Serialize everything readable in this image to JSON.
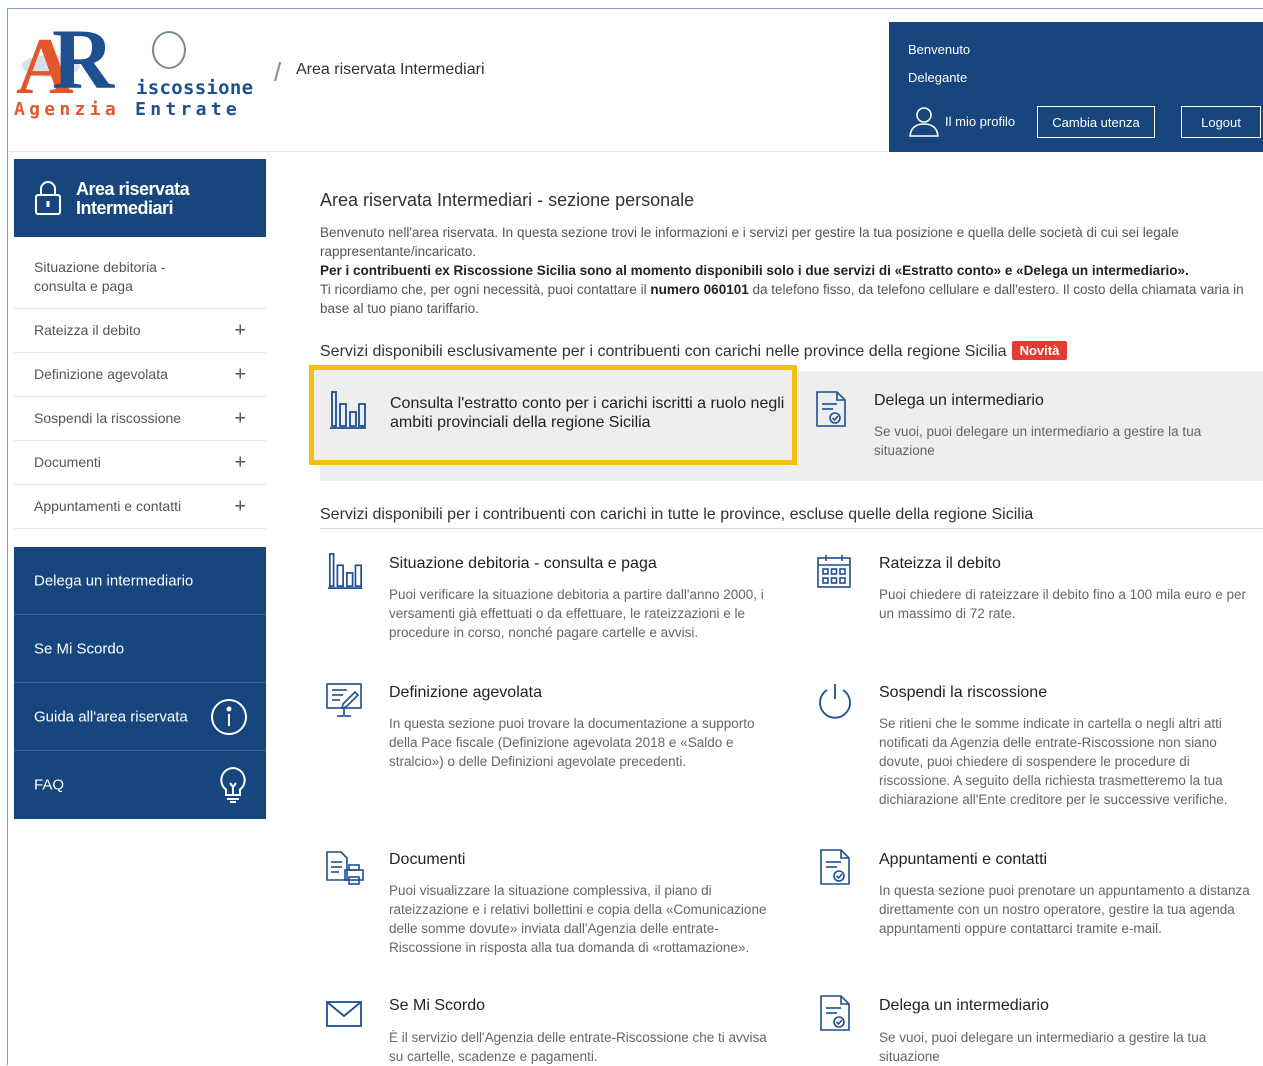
{
  "header": {
    "logo_iscossione": "iscossione",
    "logo_agenzia": "Agenzia",
    "logo_entrate": "Entrate",
    "breadcrumb": "Area riservata Intermediari",
    "user": {
      "welcome": "Benvenuto",
      "role": "Delegante",
      "profile": "Il mio profilo",
      "change_user": "Cambia utenza",
      "logout": "Logout"
    }
  },
  "sidebar": {
    "title_line1": "Area riservata",
    "title_line2": "Intermediari",
    "menu": [
      {
        "line1": "Situazione debitoria -",
        "line2": "consulta e paga"
      },
      {
        "label": "Rateizza il debito"
      },
      {
        "label": "Definizione agevolata"
      },
      {
        "label": "Sospendi la riscossione"
      },
      {
        "label": "Documenti"
      },
      {
        "label": "Appuntamenti e contatti"
      }
    ],
    "buttons": [
      {
        "label": "Delega un intermediario"
      },
      {
        "label": "Se Mi Scordo"
      },
      {
        "label": "Guida all'area riservata"
      },
      {
        "label": "FAQ"
      }
    ]
  },
  "main": {
    "title": "Area riservata Intermediari - sezione personale",
    "intro_1": "Benvenuto nell'area riservata. In questa sezione trovi le informazioni e i servizi per gestire la tua posizione e quella delle società di cui sei legale rappresentante/incaricato.",
    "intro_2": "Per i contribuenti ex Riscossione Sicilia sono al momento disponibili solo i due servizi di «Estratto conto» e «Delega un intermediario».",
    "intro_3a": "Ti ricordiamo che, per ogni necessità, puoi contattare il ",
    "intro_3b": "numero 060101",
    "intro_3c": " da telefono fisso, da telefono cellulare e dall'estero. Il costo della chiamata varia in base al tuo piano tariffario.",
    "sicily_section": "Servizi disponibili esclusivamente per i contribuenti con carichi nelle province della regione Sicilia",
    "badge_new": "Novità",
    "sicily_cards": [
      {
        "title": "Consulta l'estratto conto per i carichi iscritti a ruolo negli ambiti provinciali della regione Sicilia"
      },
      {
        "title": "Delega un intermediario",
        "desc": "Se vuoi, puoi delegare un intermediario a gestire la tua situazione"
      }
    ],
    "other_section": "Servizi disponibili per i contribuenti con carichi in tutte le province, escluse quelle della regione Sicilia",
    "services": [
      {
        "title": "Situazione debitoria - consulta e paga",
        "desc": "Puoi verificare la situazione debitoria a partire dall'anno 2000, i versamenti già effettuati o da effettuare, le rateizzazioni e le procedure in corso, nonché pagare cartelle e avvisi."
      },
      {
        "title": "Rateizza il debito",
        "desc": "Puoi chiedere di rateizzare il debito fino a 100 mila euro e per un massimo di 72 rate."
      },
      {
        "title": "Definizione agevolata",
        "desc": "In questa sezione puoi trovare la documentazione a supporto della Pace fiscale (Definizione agevolata 2018 e «Saldo e stralcio») o delle Definizioni agevolate precedenti."
      },
      {
        "title": "Sospendi la riscossione",
        "desc": "Se ritieni che le somme indicate in cartella o negli altri atti notificati da Agenzia delle entrate-Riscossione non siano dovute, puoi chiedere di sospendere le procedure di riscossione. A seguito della richiesta trasmetteremo la tua dichiarazione all'Ente creditore per le successive verifiche."
      },
      {
        "title": "Documenti",
        "desc": "Puoi visualizzare la situazione complessiva, il piano di rateizzazione e i relativi bollettini e copia della «Comunicazione delle somme dovute» inviata dall'Agenzia delle entrate-Riscossione in risposta alla tua domanda di «rottamazione»."
      },
      {
        "title": "Appuntamenti e contatti",
        "desc": "In questa sezione puoi prenotare un appuntamento a distanza direttamente con un nostro operatore, gestire la tua agenda appuntamenti oppure contattarci tramite e-mail."
      },
      {
        "title": "Se Mi Scordo",
        "desc": "È il servizio dell'Agenzia delle entrate-Riscossione che ti avvisa su cartelle, scadenze e pagamenti."
      },
      {
        "title": "Delega un intermediario",
        "desc": "Se vuoi, puoi delegare un intermediario a gestire la tua situazione"
      }
    ]
  },
  "colors": {
    "brand_blue": "#17467e",
    "highlight": "#f6bd12",
    "badge": "#e03c31"
  },
  "icons": [
    "lock-icon",
    "user-icon",
    "info-icon",
    "lightbulb-icon",
    "bar-chart-icon",
    "document-check-icon",
    "calendar-icon",
    "monitor-pen-icon",
    "power-icon",
    "documents-printer-icon",
    "envelope-icon",
    "plus-icon"
  ]
}
